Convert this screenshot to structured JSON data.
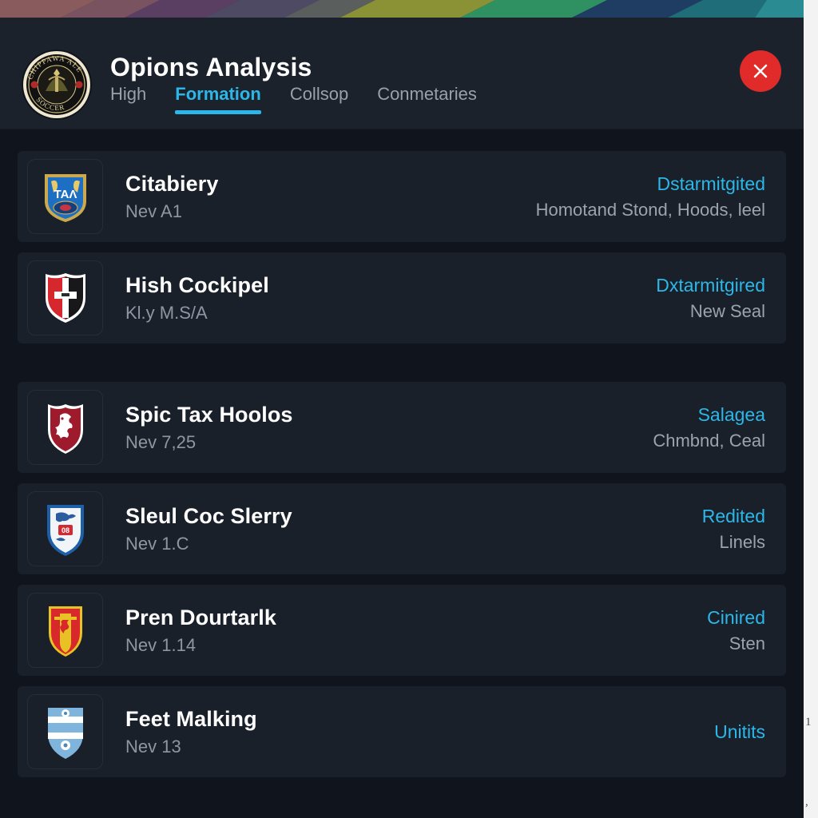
{
  "window": {
    "title": "Opions Analysis",
    "logo_icon": "club-crest-icon",
    "close_icon": "close-x-icon",
    "accent_color": "#2cb7e8",
    "close_color": "#e12b2b",
    "header_bg": "#1b222c",
    "body_bg": "#10151d",
    "row_bg": "#1a202a"
  },
  "tabs": [
    {
      "label": "High",
      "active": false
    },
    {
      "label": "Formation",
      "active": true
    },
    {
      "label": "Collsop",
      "active": false
    },
    {
      "label": "Conmetaries",
      "active": false
    }
  ],
  "list": [
    {
      "badge_icon": "shield-badge-blue-tal-icon",
      "title": "Citabiery",
      "subtitle": "Nev A1",
      "status": "Dstarmitgited",
      "detail": "Homotand Stond, Hoods, leel"
    },
    {
      "badge_icon": "shield-badge-red-black-cross-icon",
      "title": "Hish Cockipel",
      "subtitle": "Kl.y M.S/A",
      "status": "Dxtarmitgired",
      "detail": "New Seal"
    },
    {
      "badge_icon": "shield-badge-crimson-lion-icon",
      "title": "Spic Tax Hoolos",
      "subtitle": "Nev 7,25",
      "status": "Salagea",
      "detail": "Chmbnd, Ceal"
    },
    {
      "badge_icon": "shield-badge-blue-white-lion-icon",
      "title": "Sleul Coc Slerry",
      "subtitle": "Nev 1.C",
      "status": "Redited",
      "detail": "Linels"
    },
    {
      "badge_icon": "shield-badge-red-yellow-icon",
      "title": "Pren Dourtarlk",
      "subtitle": "Nev 1.14",
      "status": "Cinired",
      "detail": "Sten"
    },
    {
      "badge_icon": "shield-badge-light-blue-striped-icon",
      "title": "Feet Malking",
      "subtitle": "Nev 13",
      "status": "Unitits",
      "detail": ""
    }
  ]
}
